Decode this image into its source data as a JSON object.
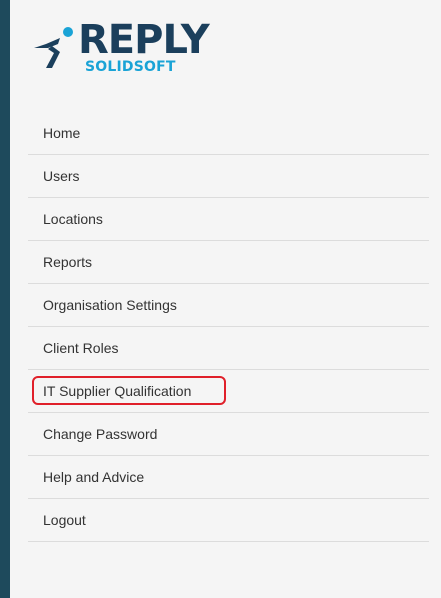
{
  "brand": {
    "name": "REPLY",
    "subtitle": "SOLIDSOFT",
    "colors": {
      "primary": "#1b3f5c",
      "accent": "#1aa3d6",
      "frame": "#1e4a5c",
      "highlight": "#e0202a"
    }
  },
  "menu": {
    "items": [
      {
        "label": "Home"
      },
      {
        "label": "Users"
      },
      {
        "label": "Locations"
      },
      {
        "label": "Reports"
      },
      {
        "label": "Organisation Settings"
      },
      {
        "label": "Client Roles"
      },
      {
        "label": "IT Supplier Qualification",
        "highlighted": true
      },
      {
        "label": "Change Password"
      },
      {
        "label": "Help and Advice"
      },
      {
        "label": "Logout"
      }
    ]
  }
}
